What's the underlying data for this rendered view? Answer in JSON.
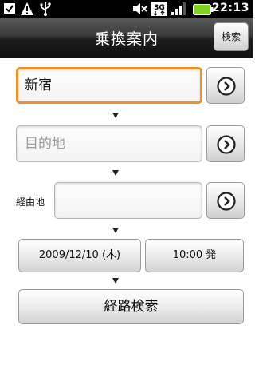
{
  "status_bar": {
    "time": "22:13",
    "icons": [
      "download-icon",
      "warning-icon",
      "usb-icon",
      "mute-icon",
      "3g-icon",
      "signal-icon",
      "battery-icon"
    ]
  },
  "header": {
    "title": "乗換案内",
    "search_label": "検索"
  },
  "form": {
    "from_value": "新宿",
    "to_placeholder": "目的地",
    "via_label": "経由地",
    "via_value": "",
    "date_label": "2009/12/10 (木)",
    "time_label": "10:00 発",
    "route_search_label": "経路検索"
  },
  "colors": {
    "focus_border": "#f0902a",
    "status_bar_bg": "#000000",
    "battery_green": "#7fd321"
  }
}
